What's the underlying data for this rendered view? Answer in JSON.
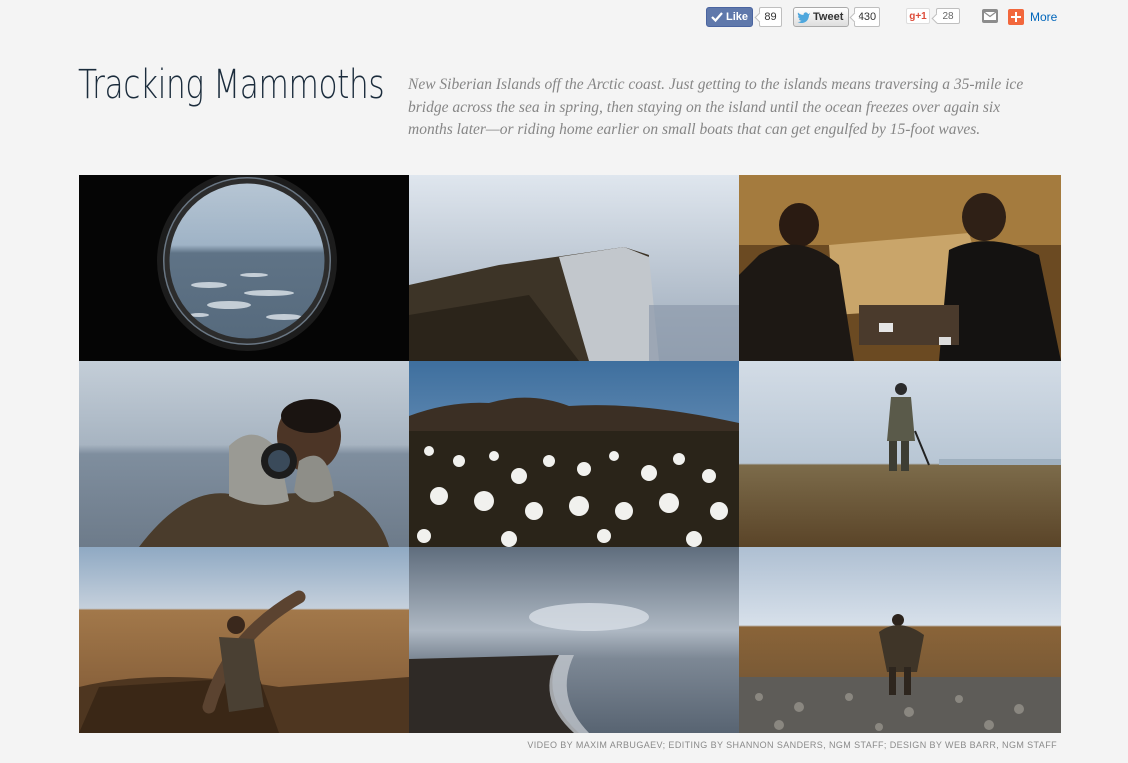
{
  "social": {
    "like_label": "Like",
    "like_count": "89",
    "tweet_label": "Tweet",
    "tweet_count": "430",
    "gplus_label": "g+1",
    "gplus_count": "28",
    "more_label": "More",
    "colors": {
      "facebook": "#5f78ab",
      "gplus": "#dd4b39",
      "more": "#f2673c"
    }
  },
  "header": {
    "title": "Tracking Mammoths",
    "description": "New Siberian Islands off the Arctic coast. Just getting to the islands means traversing a 35-mile ice bridge across the sea in spring, then staying on the island until the ocean freezes over again six months later—or riding home earlier on small boats that can get engulfed by 15-foot waves."
  },
  "gallery": {
    "tiles": [
      {
        "subject": "porthole-view-sea-ice"
      },
      {
        "subject": "foggy-sea-cliff"
      },
      {
        "subject": "two-men-playing-cards-in-tent"
      },
      {
        "subject": "man-with-binoculars"
      },
      {
        "subject": "cotton-grass-tundra"
      },
      {
        "subject": "man-standing-on-tundra"
      },
      {
        "subject": "man-carrying-mammoth-tusk"
      },
      {
        "subject": "shoreline-under-clouds"
      },
      {
        "subject": "man-carrying-load-on-rocky-beach"
      }
    ]
  },
  "credit": "VIDEO BY MAXIM ARBUGAEV; EDITING BY SHANNON SANDERS, NGM STAFF; DESIGN BY WEB BARR, NGM STAFF"
}
